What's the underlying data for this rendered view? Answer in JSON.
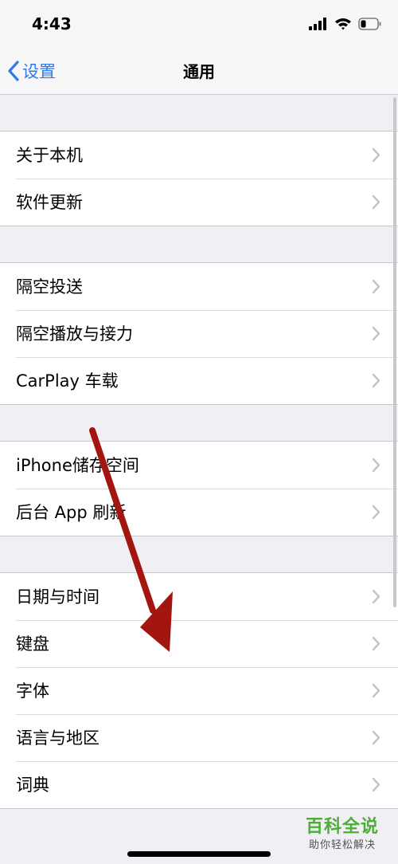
{
  "status_bar": {
    "time": "4:43",
    "icons": [
      "cellular-signal-icon",
      "wifi-icon",
      "battery-icon"
    ]
  },
  "nav": {
    "back_label": "设置",
    "title": "通用"
  },
  "groups": [
    {
      "items": [
        {
          "label": "关于本机"
        },
        {
          "label": "软件更新"
        }
      ]
    },
    {
      "items": [
        {
          "label": "隔空投送"
        },
        {
          "label": "隔空播放与接力"
        },
        {
          "label": "CarPlay 车载"
        }
      ]
    },
    {
      "items": [
        {
          "label": "iPhone储存空间"
        },
        {
          "label": "后台 App 刷新"
        }
      ]
    },
    {
      "items": [
        {
          "label": "日期与时间"
        },
        {
          "label": "键盘"
        },
        {
          "label": "字体"
        },
        {
          "label": "语言与地区"
        },
        {
          "label": "词典"
        }
      ]
    }
  ],
  "watermark": {
    "title": "百科全说",
    "subtitle": "助你轻松解决"
  },
  "colors": {
    "accent": "#2f7ae5",
    "background": "#efeff4",
    "arrow": "#a3160f",
    "watermark": "#4caf34"
  }
}
